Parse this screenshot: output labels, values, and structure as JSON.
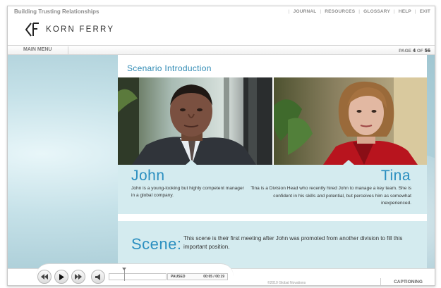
{
  "header": {
    "course_title": "Building Trusting Relationships",
    "nav": [
      "JOURNAL",
      "RESOURCES",
      "GLOSSARY",
      "HELP",
      "EXIT"
    ],
    "logo_text": "KORN FERRY"
  },
  "menu_bar": {
    "main_menu_label": "MAIN MENU",
    "page_label": "PAGE",
    "page_current": "4",
    "page_of": "OF",
    "page_total": "56"
  },
  "content": {
    "title": "Scenario Introduction",
    "characters": [
      {
        "name": "John",
        "description": "John is a young-looking but highly competent manager in a global company."
      },
      {
        "name": "Tina",
        "description": "Tina is a Division Head who recently hired John to manage a key team. She is confident in his skills and potential, but perceives him as somewhat inexperienced."
      }
    ],
    "scene_label": "Scene:",
    "scene_text": "This scene is their first meeting after John was promoted from another division to fill this important position."
  },
  "player": {
    "status": "PAUSED",
    "time": "00:05 / 00:19",
    "progress": 0.26,
    "copyright": "©2010 Global Novations",
    "captioning_label": "CAPTIONING"
  },
  "colors": {
    "accent_blue": "#2b8fc0",
    "panel_tint": "#d4ebef",
    "stage_bg": "#a9ccd6"
  }
}
